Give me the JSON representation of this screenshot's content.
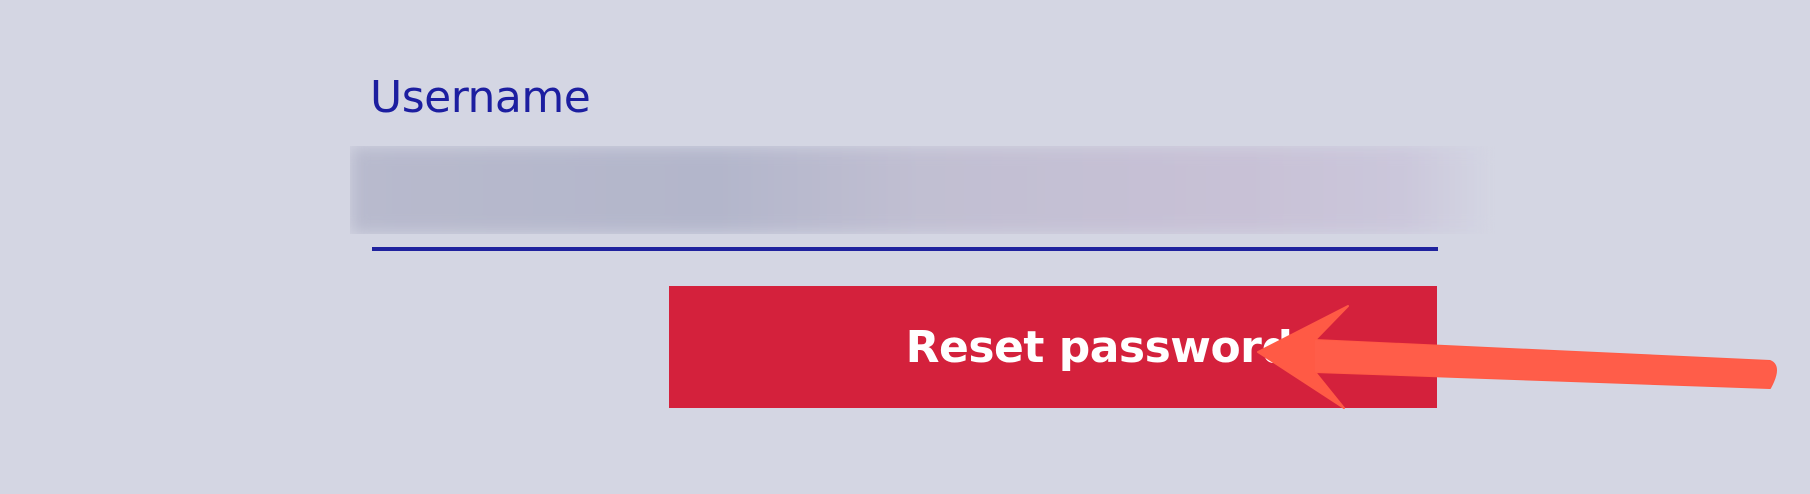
{
  "form": {
    "username_label": "Username",
    "reset_label": "Reset password"
  },
  "colors": {
    "background": "#d4d6e3",
    "label": "#1c1ea0",
    "underline": "#1f229e",
    "button": "#d4213c",
    "button_text": "#ffffff",
    "arrow": "#ff5a45"
  },
  "icons": {
    "annotation": "callout-arrow-icon"
  }
}
